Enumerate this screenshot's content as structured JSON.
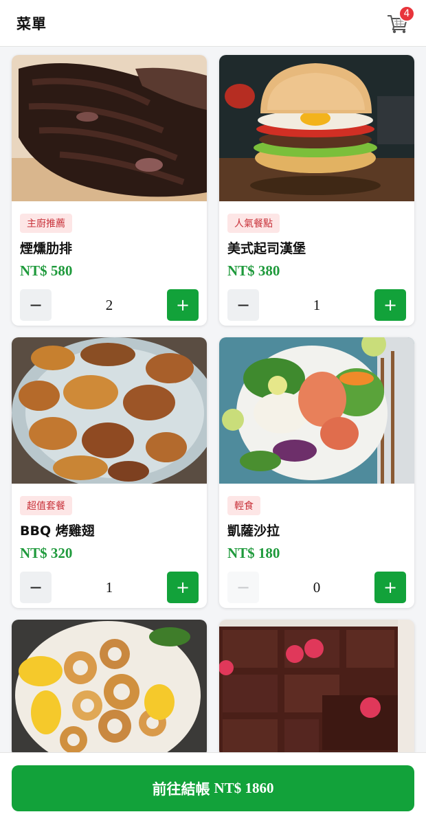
{
  "header": {
    "title": "菜單",
    "cart_count": "4"
  },
  "products": [
    {
      "tag": "主廚推薦",
      "name": "煙燻肋排",
      "price": "NT$ 580",
      "qty": "2",
      "minus_enabled": true,
      "image": "smoked-ribs"
    },
    {
      "tag": "人氣餐點",
      "name": "美式起司漢堡",
      "price": "NT$ 380",
      "qty": "1",
      "minus_enabled": true,
      "image": "cheeseburger"
    },
    {
      "tag": "超值套餐",
      "name": "BBQ 烤雞翅",
      "price": "NT$ 320",
      "qty": "1",
      "minus_enabled": true,
      "image": "bbq-wings"
    },
    {
      "tag": "輕食",
      "name": "凱薩沙拉",
      "price": "NT$ 180",
      "qty": "0",
      "minus_enabled": false,
      "image": "salad"
    },
    {
      "image": "fried-calamari"
    },
    {
      "image": "brownie"
    }
  ],
  "buttons": {
    "minus": "−",
    "plus": "+"
  },
  "checkout": {
    "label": "前往結帳",
    "total": "NT$ 1860"
  },
  "colors": {
    "accent": "#12a23a",
    "price": "#1f9a3c",
    "badge": "#e8343b",
    "tag_bg": "#fde6e6",
    "tag_text": "#c8323a"
  }
}
